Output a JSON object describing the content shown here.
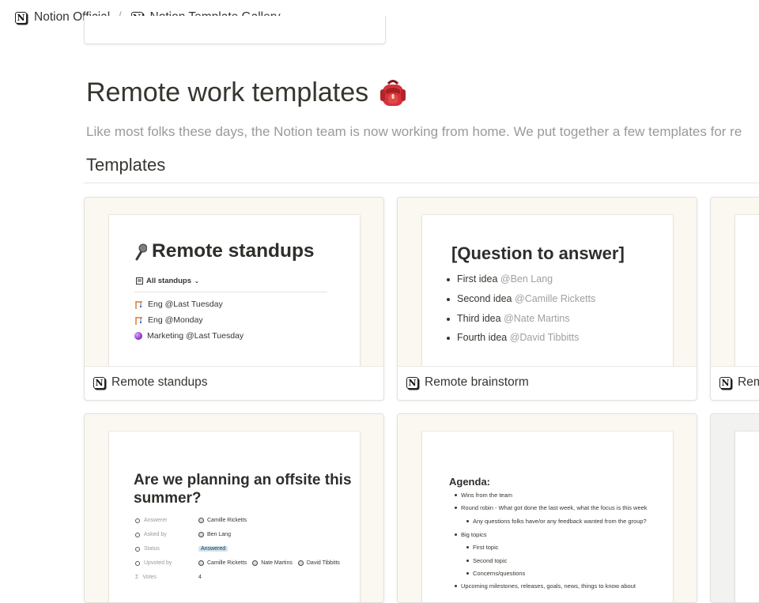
{
  "breadcrumb": [
    "Notion Official",
    "Notion Template Gallery"
  ],
  "page": {
    "title": "Remote work templates",
    "description": "Like most folks these days, the Notion team is now working from home. We put together a few templates for re",
    "section": "Templates"
  },
  "cards": [
    {
      "caption": "Remote standups"
    },
    {
      "caption": "Remote brainstorm"
    },
    {
      "caption": "Rem"
    }
  ],
  "standups": {
    "title": "Remote standups",
    "view": "All standups",
    "rows": [
      "Eng @Last Tuesday",
      "Eng @Monday",
      "Marketing @Last Tuesday"
    ]
  },
  "brainstorm": {
    "title": "[Question to answer]",
    "items": [
      {
        "text": "First idea",
        "mention": "@Ben Lang"
      },
      {
        "text": "Second idea",
        "mention": "@Camille Ricketts"
      },
      {
        "text": "Third idea",
        "mention": "@Nate Martins"
      },
      {
        "text": "Fourth idea",
        "mention": "@David Tibbitts"
      }
    ]
  },
  "offsite": {
    "title": "Are we planning an offsite this summer?",
    "props": [
      {
        "label": "Answerer",
        "value": "Camille Ricketts"
      },
      {
        "label": "Asked by",
        "value": "Ben Lang"
      },
      {
        "label": "Status",
        "value": "Answered"
      },
      {
        "label": "Upvoted by",
        "values": [
          "Camille Ricketts",
          "Nate Martins",
          "David Tibbitts"
        ]
      },
      {
        "label": "Votes",
        "value": "4"
      }
    ]
  },
  "agenda": {
    "title": "Agenda:",
    "items": [
      "Wins from the team",
      "Round robin - What got done the last week, what the focus is this week",
      "Any questions folks have/or any feedback wanted from the group?",
      "Big topics",
      "First topic",
      "Second topic",
      "Concerns/questions",
      "Upcoming milestones, releases, goals, news, things to know about"
    ]
  }
}
